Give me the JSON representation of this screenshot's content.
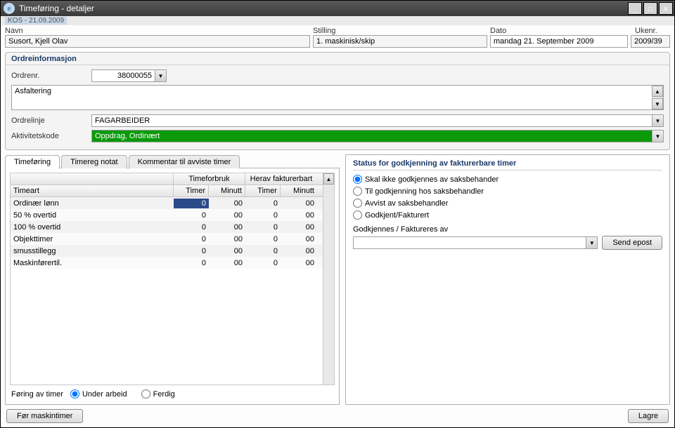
{
  "window": {
    "title": "Timeføring - detaljer",
    "subheader": "KOS - 21.09.2009"
  },
  "header": {
    "labels": {
      "name": "Navn",
      "position": "Stilling",
      "date": "Dato",
      "week": "Ukenr."
    },
    "name": "Susort, Kjell Olav",
    "position": "1. maskinisk/skip",
    "date": "mandag 21. September 2009",
    "week": "2009/39"
  },
  "order": {
    "section_title": "Ordreinformasjon",
    "labels": {
      "ordernr": "Ordrenr.",
      "orderline": "Ordrelinje",
      "activity": "Aktivitetskode"
    },
    "ordernr": "38000055",
    "description": "Asfaltering",
    "orderline": "FAGARBEIDER",
    "activity": "Oppdrag, Ordinært"
  },
  "tabs": {
    "items": [
      "Timeføring",
      "Timereg notat",
      "Kommentar til avviste timer"
    ]
  },
  "grid": {
    "group_headers": {
      "forbruk": "Timeforbruk",
      "fakturerbart": "Herav fakturerbart"
    },
    "cols": {
      "timeart": "Timeart",
      "timer": "Timer",
      "minutt": "Minutt"
    },
    "rows": [
      {
        "name": "Ordinær lønn",
        "t1": "0",
        "m1": "00",
        "t2": "0",
        "m2": "00",
        "sel": true
      },
      {
        "name": "50 % overtid",
        "t1": "0",
        "m1": "00",
        "t2": "0",
        "m2": "00"
      },
      {
        "name": "100 % overtid",
        "t1": "0",
        "m1": "00",
        "t2": "0",
        "m2": "00"
      },
      {
        "name": "Objekttimer",
        "t1": "0",
        "m1": "00",
        "t2": "0",
        "m2": "00"
      },
      {
        "name": "smusstillegg",
        "t1": "0",
        "m1": "00",
        "t2": "0",
        "m2": "00"
      },
      {
        "name": "Maskinførertil.",
        "t1": "0",
        "m1": "00",
        "t2": "0",
        "m2": "00"
      }
    ]
  },
  "timer_status": {
    "label": "Føring av timer",
    "opts": [
      "Under arbeid",
      "Ferdig"
    ]
  },
  "approval": {
    "title": "Status for godkjenning av fakturerbare timer",
    "opts": [
      "Skal ikke godkjennes av saksbehander",
      "Til godkjenning hos saksbehandler",
      "Avvist av saksbehandler",
      "Godkjent/Fakturert"
    ],
    "approver_label": "Godkjennes / Faktureres av",
    "approver": "",
    "send_email": "Send epost"
  },
  "footer": {
    "maskintimer": "Før maskintimer",
    "save": "Lagre"
  },
  "glyphs": {
    "down": "▼",
    "up": "▲",
    "min": "_",
    "max": "☐",
    "close": "✕"
  }
}
